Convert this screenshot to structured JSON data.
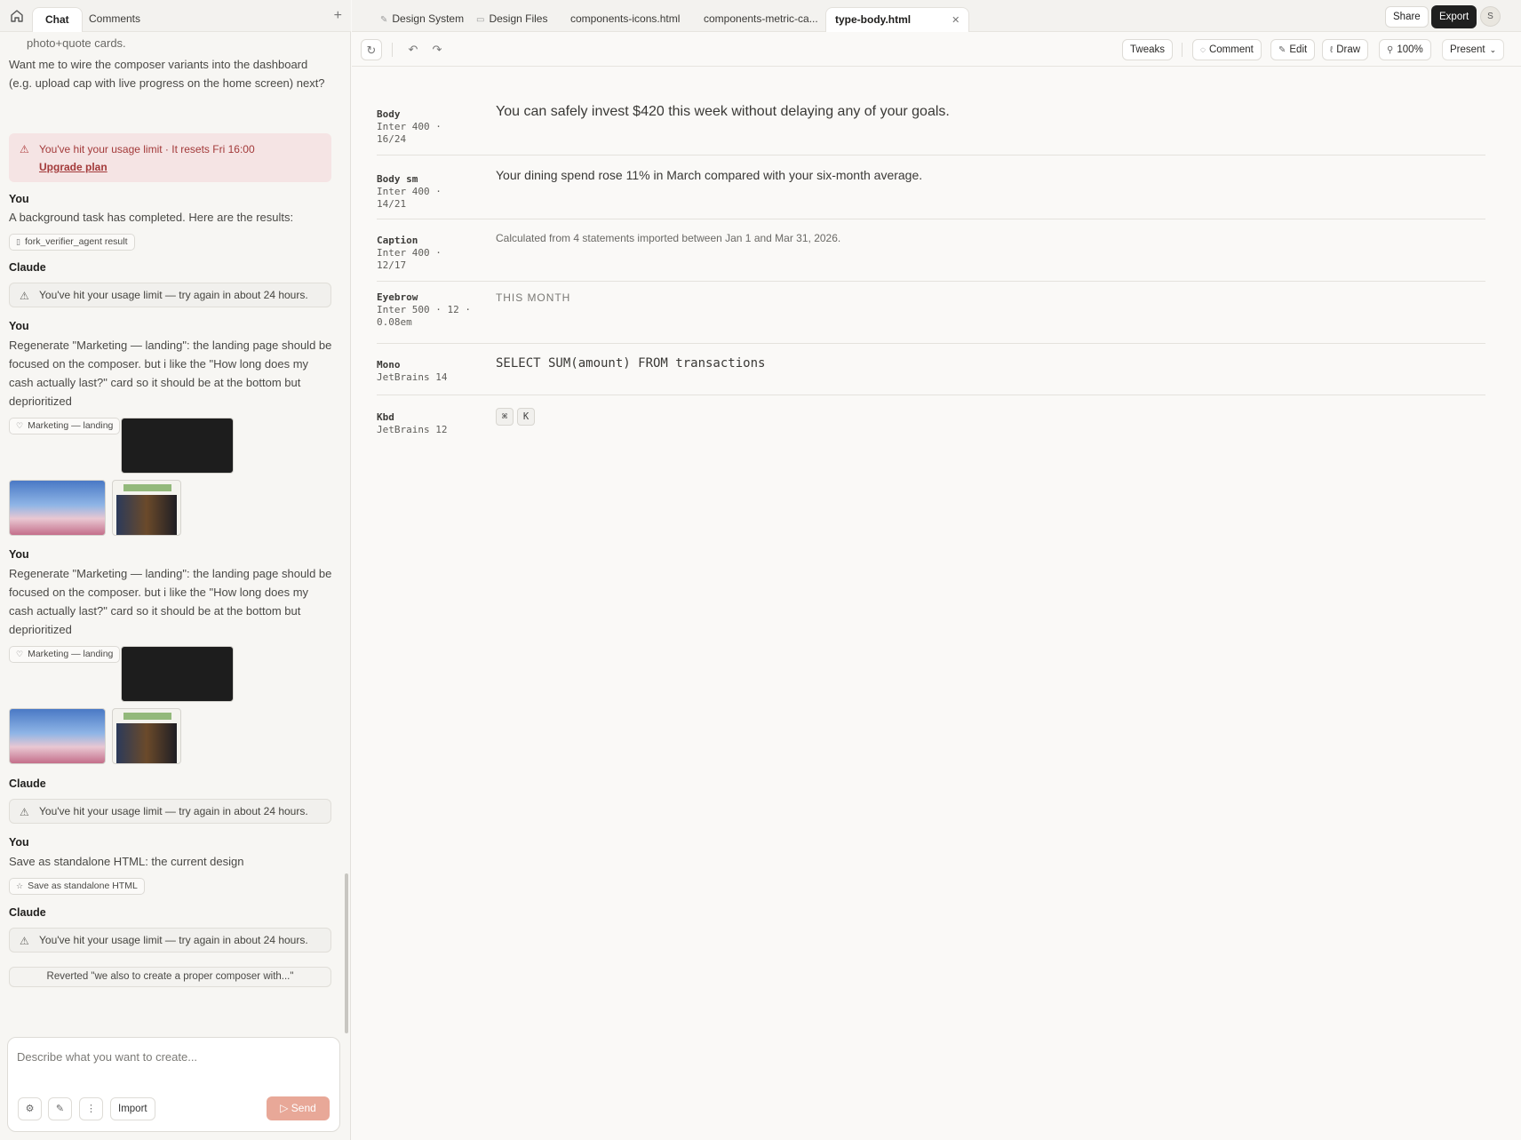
{
  "left_tabs": {
    "chat": "Chat",
    "comments": "Comments"
  },
  "chat": {
    "prev_tail": "photo+quote cards.",
    "prev_question": "Want me to wire the composer variants into the dashboard (e.g. upload cap with live progress on the home screen) next?",
    "limit_banner": {
      "text": "You've hit your usage limit · It resets Fri 16:00",
      "link": "Upgrade plan"
    },
    "you_label": "You",
    "claude_label": "Claude",
    "m1_text": "A background task has completed. Here are the results:",
    "m1_chip": "fork_verifier_agent result",
    "claude_limit": "You've hit your usage limit — try again in about 24 hours.",
    "regen_text": "Regenerate \"Marketing — landing\": the landing page should be focused on the composer. but i like the \"How long does my cash actually last?\" card so it should be at the bottom but deprioritized",
    "regen_chip": "Marketing — landing",
    "save_text": "Save as standalone HTML: the current design",
    "save_chip": "Save as standalone HTML",
    "reverted": "Reverted \"we also to create a proper composer with...\""
  },
  "composer": {
    "placeholder": "Describe what you want to create...",
    "import": "Import",
    "send": "Send"
  },
  "file_tabs": {
    "t1": "Design System",
    "t2": "Design Files",
    "t3": "components-icons.html",
    "t4": "components-metric-ca...",
    "t5": "type-body.html"
  },
  "header_actions": {
    "share": "Share",
    "export": "Export",
    "avatar": "S"
  },
  "toolbar": {
    "tweaks": "Tweaks",
    "comment": "Comment",
    "edit": "Edit",
    "draw": "Draw",
    "zoom": "100%",
    "present": "Present"
  },
  "type_rows": {
    "body": {
      "name": "Body",
      "meta": "Inter 400 · 16/24",
      "sample": "You can safely invest $420 this week without delaying any of your goals."
    },
    "body_sm": {
      "name": "Body sm",
      "meta": "Inter 400 · 14/21",
      "sample": "Your dining spend rose 11% in March compared with your six-month average."
    },
    "caption": {
      "name": "Caption",
      "meta": "Inter 400 · 12/17",
      "sample": "Calculated from 4 statements imported between Jan 1 and Mar 31, 2026."
    },
    "eyebrow": {
      "name": "Eyebrow",
      "meta": "Inter 500 · 12 · 0.08em",
      "sample": "THIS MONTH"
    },
    "mono": {
      "name": "Mono",
      "meta": "JetBrains 14",
      "sample": "SELECT SUM(amount) FROM transactions"
    },
    "kbd": {
      "name": "Kbd",
      "meta": "JetBrains 12",
      "keys": [
        "⌘",
        "K"
      ]
    }
  }
}
